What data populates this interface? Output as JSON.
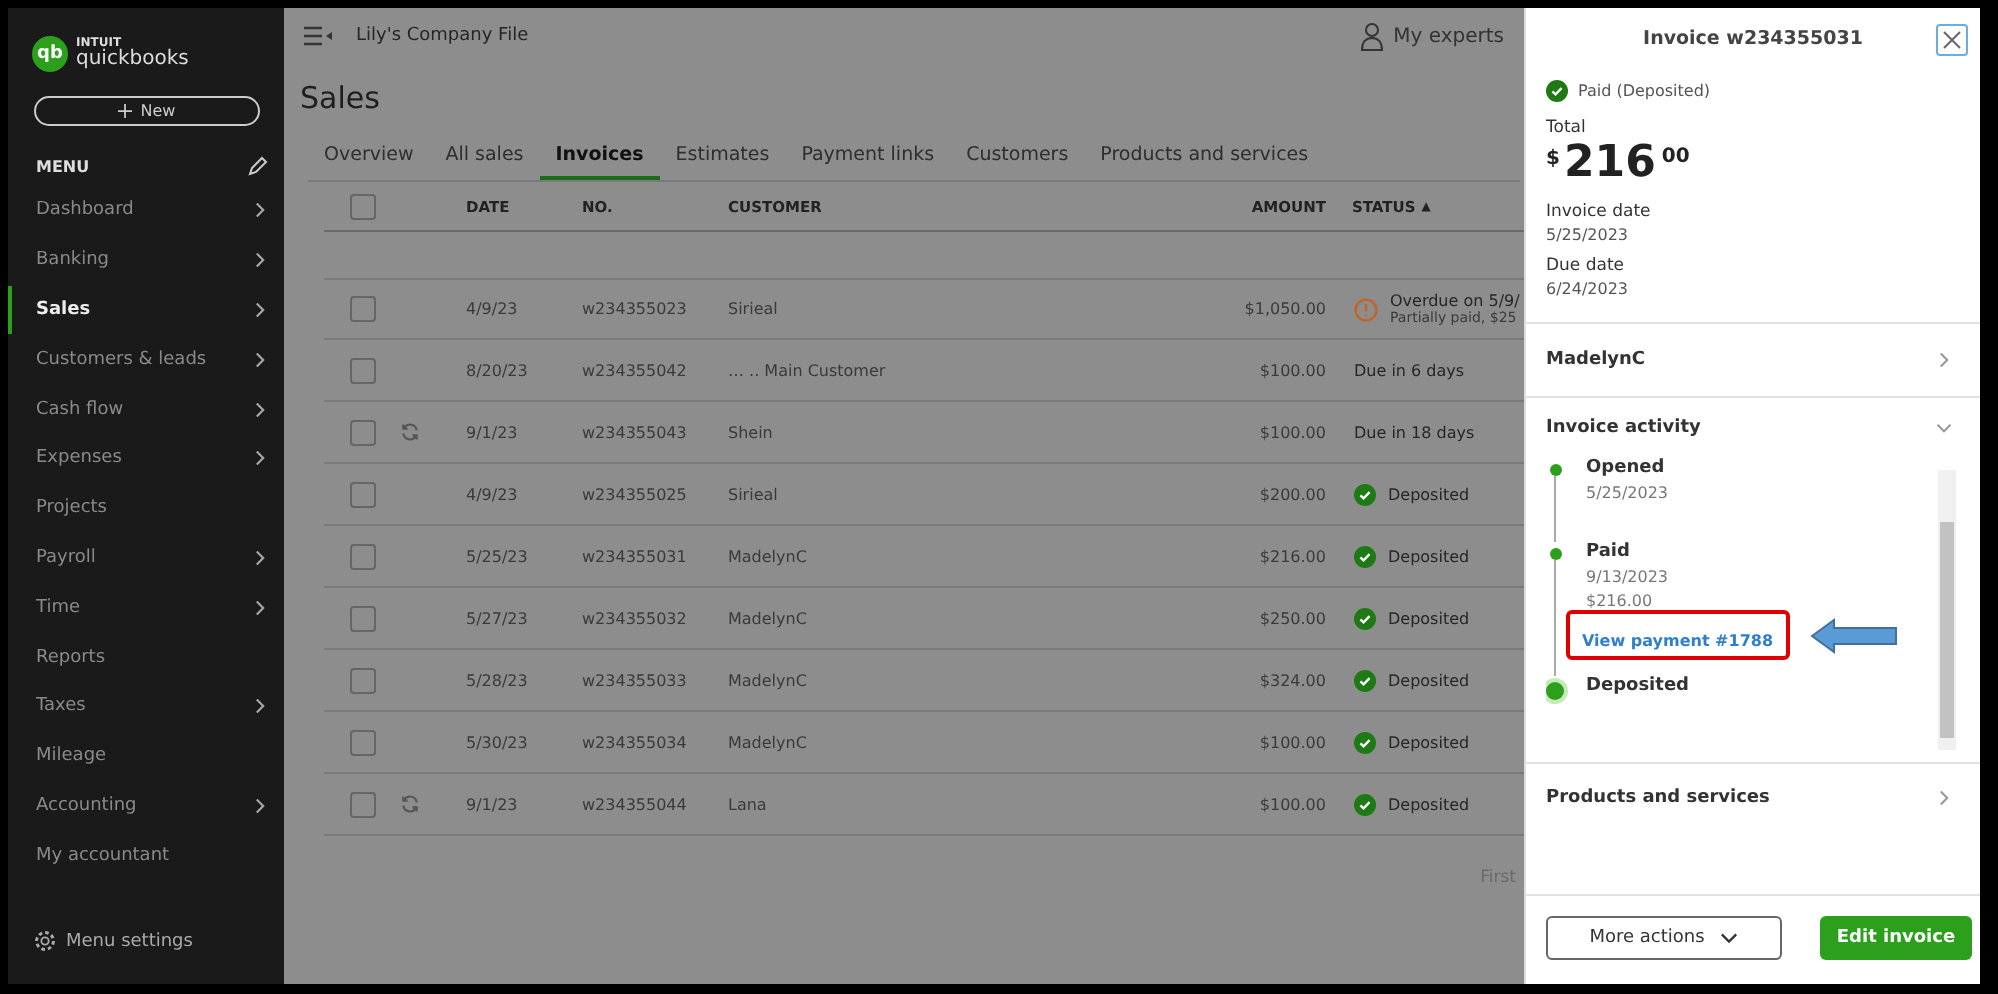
{
  "sidebar": {
    "logo": {
      "maker": "INTUIT",
      "product": "quickbooks",
      "mark": "qb"
    },
    "new_button": "New",
    "menu_title": "MENU",
    "items": [
      {
        "label": "Dashboard",
        "has_arrow": true,
        "selected": false
      },
      {
        "label": "Banking",
        "has_arrow": true,
        "selected": false
      },
      {
        "label": "Sales",
        "has_arrow": true,
        "selected": true
      },
      {
        "label": "Customers & leads",
        "has_arrow": true,
        "selected": false
      },
      {
        "label": "Cash flow",
        "has_arrow": true,
        "selected": false
      },
      {
        "label": "Expenses",
        "has_arrow": true,
        "selected": false
      },
      {
        "label": "Projects",
        "has_arrow": false,
        "selected": false
      },
      {
        "label": "Payroll",
        "has_arrow": true,
        "selected": false
      },
      {
        "label": "Time",
        "has_arrow": true,
        "selected": false
      },
      {
        "label": "Reports",
        "has_arrow": false,
        "selected": false
      },
      {
        "label": "Taxes",
        "has_arrow": true,
        "selected": false
      },
      {
        "label": "Mileage",
        "has_arrow": false,
        "selected": false
      },
      {
        "label": "Accounting",
        "has_arrow": true,
        "selected": false
      },
      {
        "label": "My accountant",
        "has_arrow": false,
        "selected": false
      }
    ],
    "footer": "Menu settings"
  },
  "topbar": {
    "company": "Lily's Company File",
    "experts": "My experts"
  },
  "page_title": "Sales",
  "tabs": [
    {
      "label": "Overview",
      "selected": false
    },
    {
      "label": "All sales",
      "selected": false
    },
    {
      "label": "Invoices",
      "selected": true
    },
    {
      "label": "Estimates",
      "selected": false
    },
    {
      "label": "Payment links",
      "selected": false
    },
    {
      "label": "Customers",
      "selected": false
    },
    {
      "label": "Products and services",
      "selected": false
    }
  ],
  "table": {
    "columns": [
      "DATE",
      "NO.",
      "CUSTOMER",
      "AMOUNT",
      "STATUS"
    ],
    "sort_mark": "▲",
    "select_all_checked": false,
    "rows": [
      {
        "checked": false,
        "date": "4/9/23",
        "no": "w234355023",
        "customer": "Sirieal",
        "amount": "$1,050.00",
        "recurring": false,
        "status": {
          "kind": "warning",
          "text": "Overdue on 5/9/",
          "subtext": "Partially paid, $25"
        }
      },
      {
        "checked": false,
        "date": "8/20/23",
        "no": "w234355042",
        "customer": "… .. Main Customer",
        "amount": "$100.00",
        "recurring": false,
        "status": {
          "kind": "plain",
          "text": "Due in 6 days"
        }
      },
      {
        "checked": false,
        "date": "9/1/23",
        "no": "w234355043",
        "customer": "Shein",
        "amount": "$100.00",
        "recurring": true,
        "status": {
          "kind": "plain",
          "text": "Due in 18 days"
        }
      },
      {
        "checked": false,
        "date": "4/9/23",
        "no": "w234355025",
        "customer": "Sirieal",
        "amount": "$200.00",
        "recurring": false,
        "status": {
          "kind": "done",
          "text": "Deposited"
        }
      },
      {
        "checked": false,
        "date": "5/25/23",
        "no": "w234355031",
        "customer": "MadelynC",
        "amount": "$216.00",
        "recurring": false,
        "status": {
          "kind": "done",
          "text": "Deposited"
        }
      },
      {
        "checked": false,
        "date": "5/27/23",
        "no": "w234355032",
        "customer": "MadelynC",
        "amount": "$250.00",
        "recurring": false,
        "status": {
          "kind": "done",
          "text": "Deposited"
        }
      },
      {
        "checked": false,
        "date": "5/28/23",
        "no": "w234355033",
        "customer": "MadelynC",
        "amount": "$324.00",
        "recurring": false,
        "status": {
          "kind": "done",
          "text": "Deposited"
        }
      },
      {
        "checked": false,
        "date": "5/30/23",
        "no": "w234355034",
        "customer": "MadelynC",
        "amount": "$100.00",
        "recurring": false,
        "status": {
          "kind": "done",
          "text": "Deposited"
        }
      },
      {
        "checked": false,
        "date": "9/1/23",
        "no": "w234355044",
        "customer": "Lana",
        "amount": "$100.00",
        "recurring": true,
        "status": {
          "kind": "done",
          "text": "Deposited"
        }
      }
    ],
    "pager": "First"
  },
  "panel": {
    "title": "Invoice w234355031",
    "status": "Paid (Deposited)",
    "total_label": "Total",
    "total": {
      "currency": "$",
      "whole": "216",
      "cents": "00"
    },
    "dates": [
      {
        "label": "Invoice date",
        "value": "5/25/2023"
      },
      {
        "label": "Due date",
        "value": "6/24/2023"
      }
    ],
    "customer": "MadelynC",
    "activity": {
      "title": "Invoice activity",
      "expanded": true,
      "events": [
        {
          "title": "Opened",
          "lines": [
            "5/25/2023"
          ],
          "current": false
        },
        {
          "title": "Paid",
          "lines": [
            "9/13/2023",
            "$216.00"
          ],
          "link": "View payment #1788",
          "current": false
        },
        {
          "title": "Deposited",
          "current": true
        }
      ]
    },
    "products": "Products and services",
    "more_actions": "More actions",
    "edit": "Edit invoice"
  }
}
